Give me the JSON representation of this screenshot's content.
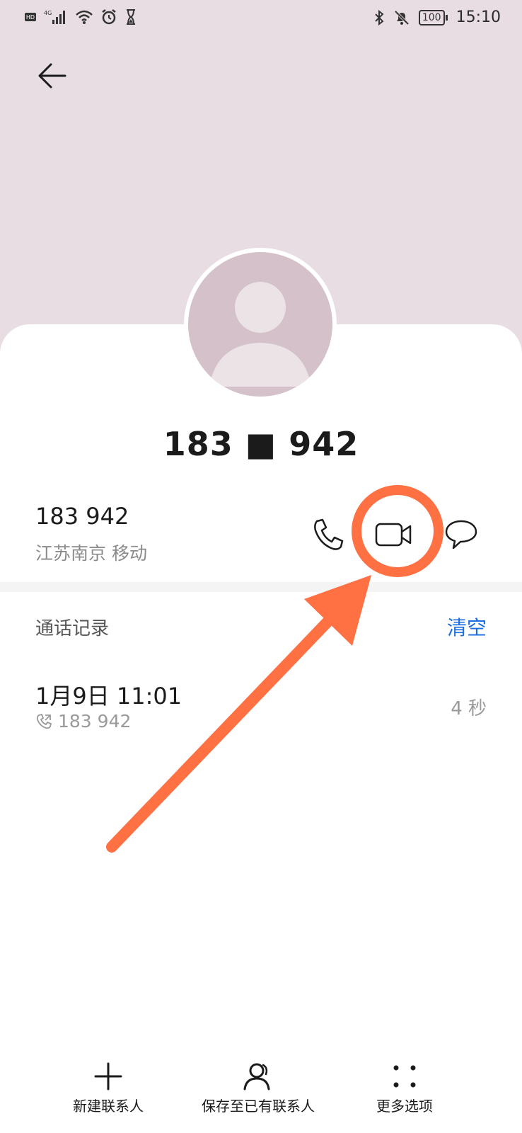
{
  "status_bar": {
    "left_icons": [
      "hd-icon",
      "signal-4g-icon",
      "wifi-icon",
      "alarm-icon",
      "hourglass-icon"
    ],
    "right_icons": [
      "bluetooth-icon",
      "mute-icon",
      "battery-icon"
    ],
    "battery_level": "100",
    "time": "15:10"
  },
  "contact": {
    "display_number": "183 ■ 942",
    "phone_number": "183 942",
    "location": "江苏南京 移动"
  },
  "actions": [
    "phone-icon",
    "video-call-icon",
    "message-icon"
  ],
  "call_log": {
    "title": "通话记录",
    "clear_label": "清空",
    "entries": [
      {
        "time": "1月9日 11:01",
        "number": "183 942",
        "duration": "4 秒"
      }
    ]
  },
  "bottom_nav": [
    {
      "label": "新建联系人",
      "icon": "add-icon"
    },
    {
      "label": "保存至已有联系人",
      "icon": "person-icon"
    },
    {
      "label": "更多选项",
      "icon": "more-icon"
    }
  ],
  "annotation": {
    "color": "#ff7043",
    "target": "video-call-button"
  }
}
